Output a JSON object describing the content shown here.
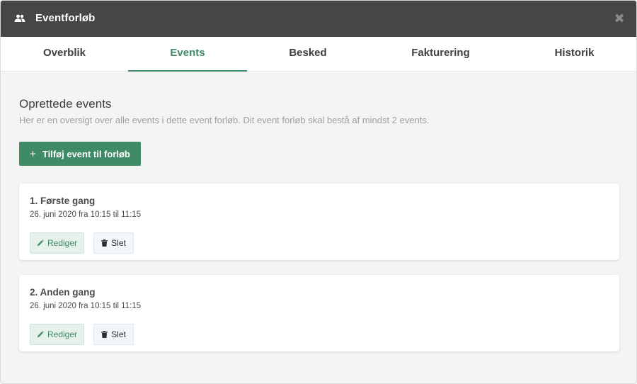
{
  "modal": {
    "title": "Eventforløb",
    "header_icon": "people-icon",
    "close_icon": "close-icon",
    "close_symbol": "✖"
  },
  "tabs": [
    {
      "label": "Overblik",
      "active": false
    },
    {
      "label": "Events",
      "active": true
    },
    {
      "label": "Besked",
      "active": false
    },
    {
      "label": "Fakturering",
      "active": false
    },
    {
      "label": "Historik",
      "active": false
    }
  ],
  "section": {
    "title": "Oprettede events",
    "description": "Her er en oversigt over alle events i dette event forløb. Dit event forløb skal bestå af mindst 2 events.",
    "add_button_label": "Tilføj event til forløb",
    "add_button_icon": "+"
  },
  "events": [
    {
      "title": "1. Første gang",
      "date": "26. juni 2020 fra 10:15 til 11:15",
      "edit_label": "Rediger",
      "delete_label": "Slet"
    },
    {
      "title": "2. Anden gang",
      "date": "26. juni 2020 fra 10:15 til 11:15",
      "edit_label": "Rediger",
      "delete_label": "Slet"
    }
  ],
  "colors": {
    "header_bg": "#464646",
    "accent": "#3f8a67",
    "page_bg": "#f4f4f4"
  }
}
